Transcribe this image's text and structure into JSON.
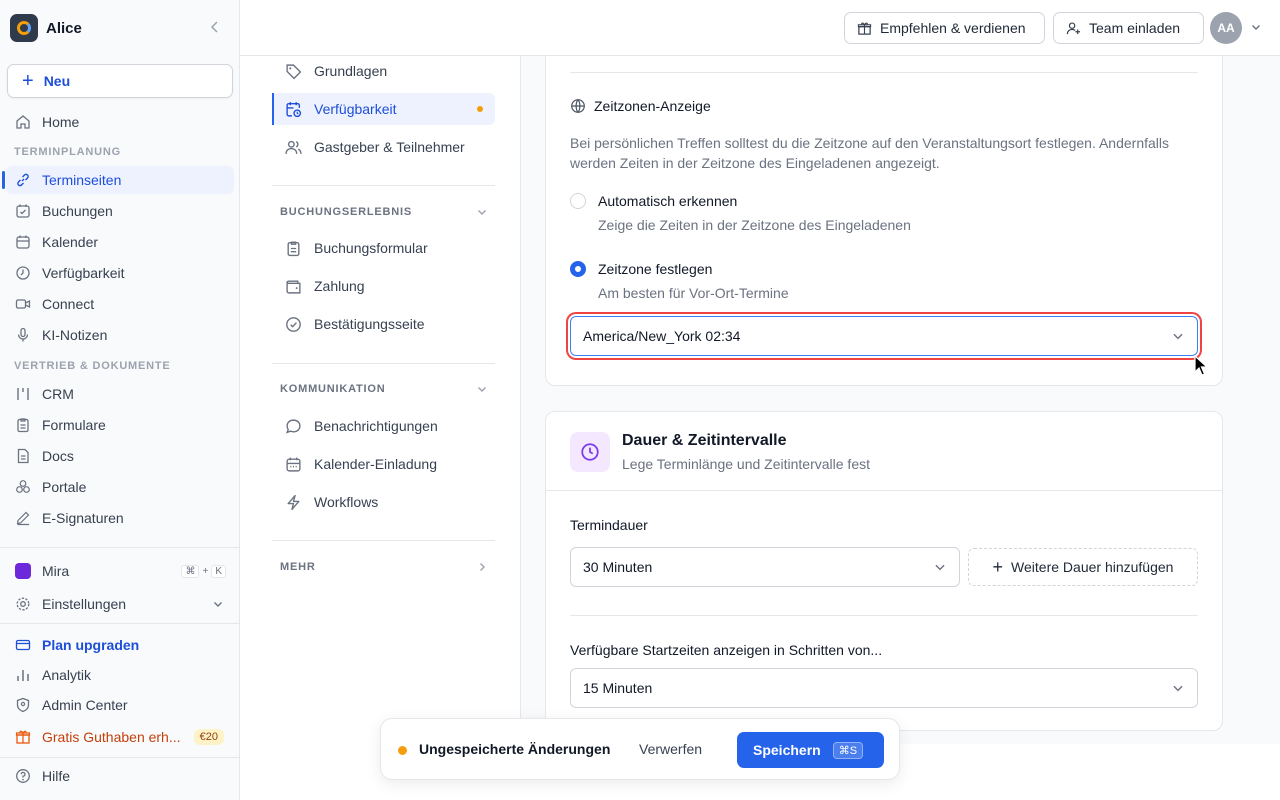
{
  "workspace": {
    "name": "Alice"
  },
  "sidebar": {
    "new_label": "Neu",
    "home": "Home",
    "section_scheduling": "TERMINPLANUNG",
    "scheduling_items": [
      {
        "label": "Terminseiten",
        "icon": "link-icon",
        "active": true
      },
      {
        "label": "Buchungen",
        "icon": "calendar-check-icon"
      },
      {
        "label": "Kalender",
        "icon": "calendar-icon"
      },
      {
        "label": "Verfügbarkeit",
        "icon": "clock-icon"
      },
      {
        "label": "Connect",
        "icon": "video-icon"
      },
      {
        "label": "KI-Notizen",
        "icon": "microphone-icon"
      }
    ],
    "section_sales": "VERTRIEB & DOKUMENTE",
    "sales_items": [
      {
        "label": "CRM",
        "icon": "crm-icon"
      },
      {
        "label": "Formulare",
        "icon": "clipboard-icon"
      },
      {
        "label": "Docs",
        "icon": "document-icon"
      },
      {
        "label": "Portale",
        "icon": "portal-icon"
      },
      {
        "label": "E-Signaturen",
        "icon": "pen-icon"
      }
    ],
    "mira": "Mira",
    "mira_shortcut": [
      "⌘",
      "+",
      "K"
    ],
    "settings": "Einstellungen",
    "upgrade": "Plan upgraden",
    "analytics": "Analytik",
    "admin": "Admin Center",
    "credit": "Gratis Guthaben erh...",
    "credit_badge": "€20",
    "help": "Hilfe"
  },
  "topbar": {
    "refer": "Empfehlen & verdienen",
    "invite": "Team einladen",
    "avatar": "AA"
  },
  "subnav": {
    "items_top": [
      {
        "label": "Grundlagen",
        "icon": "tag-icon"
      },
      {
        "label": "Verfügbarkeit",
        "icon": "calendar-clock-icon",
        "active": true
      },
      {
        "label": "Gastgeber & Teilnehmer",
        "icon": "users-icon"
      }
    ],
    "section_booking": "BUCHUNGSERLEBNIS",
    "items_booking": [
      {
        "label": "Buchungsformular",
        "icon": "clipboard-icon"
      },
      {
        "label": "Zahlung",
        "icon": "wallet-icon"
      },
      {
        "label": "Bestätigungsseite",
        "icon": "check-circle-icon"
      }
    ],
    "section_comm": "KOMMUNIKATION",
    "items_comm": [
      {
        "label": "Benachrichtigungen",
        "icon": "chat-icon"
      },
      {
        "label": "Kalender-Einladung",
        "icon": "calendar-icon"
      },
      {
        "label": "Workflows",
        "icon": "bolt-icon"
      }
    ],
    "section_more": "MEHR"
  },
  "timezone": {
    "title": "Zeitzonen-Anzeige",
    "description": "Bei persönlichen Treffen solltest du die Zeitzone auf den Veranstaltungsort festlegen. Andernfalls werden Zeiten in der Zeitzone des Eingeladenen angezeigt.",
    "option_auto_label": "Automatisch erkennen",
    "option_auto_sub": "Zeige die Zeiten in der Zeitzone des Eingeladenen",
    "option_fixed_label": "Zeitzone festlegen",
    "option_fixed_sub": "Am besten für Vor-Ort-Termine",
    "selected": "fixed",
    "select_value": "America/New_York 02:34"
  },
  "duration": {
    "title": "Dauer & Zeitintervalle",
    "subtitle": "Lege Terminlänge und Zeitintervalle fest",
    "duration_label": "Termindauer",
    "duration_value": "30 Minuten",
    "add_duration": "Weitere Dauer hinzufügen",
    "interval_label": "Verfügbare Startzeiten anzeigen in Schritten von...",
    "interval_value": "15 Minuten"
  },
  "toast": {
    "message": "Ungespeicherte Änderungen",
    "discard": "Verwerfen",
    "save": "Speichern",
    "save_shortcut": "⌘S"
  },
  "colors": {
    "accent": "#2563eb",
    "unsaved": "#f59e0b",
    "focus_ring": "#ef4444"
  }
}
